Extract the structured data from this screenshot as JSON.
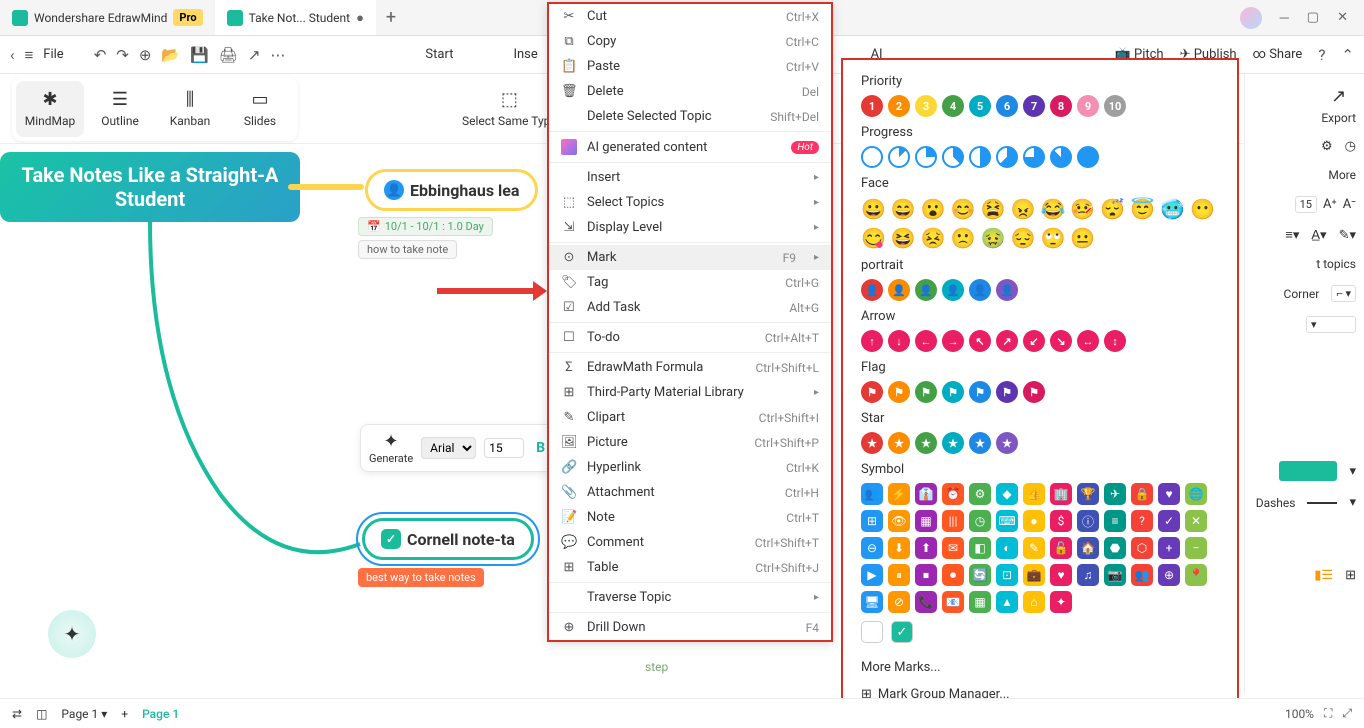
{
  "titlebar": {
    "tab1": "Wondershare EdrawMind",
    "pro": "Pro",
    "tab2": "Take Not... Student",
    "dot": "●"
  },
  "toolbar": {
    "file": "File",
    "start": "Start",
    "inse": "Inse",
    "al": "AI",
    "pitch": "Pitch",
    "publish": "Publish",
    "share": "Share"
  },
  "views": {
    "mindmap": "MindMap",
    "outline": "Outline",
    "kanban": "Kanban",
    "slides": "Slides",
    "select_same": "Select Same Type"
  },
  "canvas": {
    "root": "Take Notes Like a Straight-A Student",
    "node1": "Ebbinghaus lea",
    "chip1": "10/1 - 10/1 : 1.0 Day",
    "chip2": "how to take note",
    "node2": "Cornell note-ta",
    "tag2": "best way to take notes",
    "step": "step"
  },
  "floatbar": {
    "generate": "Generate",
    "font": "Arial",
    "size": "15"
  },
  "ctx": {
    "cut": {
      "lbl": "Cut",
      "shc": "Ctrl+X"
    },
    "copy": {
      "lbl": "Copy",
      "shc": "Ctrl+C"
    },
    "paste": {
      "lbl": "Paste",
      "shc": "Ctrl+V"
    },
    "delete": {
      "lbl": "Delete",
      "shc": "Del"
    },
    "delsel": {
      "lbl": "Delete Selected Topic",
      "shc": "Shift+Del"
    },
    "ai": {
      "lbl": "AI generated content",
      "badge": "Hot"
    },
    "insert": {
      "lbl": "Insert"
    },
    "seltopics": {
      "lbl": "Select Topics"
    },
    "displevel": {
      "lbl": "Display Level"
    },
    "mark": {
      "lbl": "Mark",
      "shc": "F9"
    },
    "tag": {
      "lbl": "Tag",
      "shc": "Ctrl+G"
    },
    "addtask": {
      "lbl": "Add Task",
      "shc": "Alt+G"
    },
    "todo": {
      "lbl": "To-do",
      "shc": "Ctrl+Alt+T"
    },
    "edrawmath": {
      "lbl": "EdrawMath Formula",
      "shc": "Ctrl+Shift+L"
    },
    "thirdparty": {
      "lbl": "Third-Party Material Library"
    },
    "clipart": {
      "lbl": "Clipart",
      "shc": "Ctrl+Shift+I"
    },
    "picture": {
      "lbl": "Picture",
      "shc": "Ctrl+Shift+P"
    },
    "hyperlink": {
      "lbl": "Hyperlink",
      "shc": "Ctrl+K"
    },
    "attachment": {
      "lbl": "Attachment",
      "shc": "Ctrl+H"
    },
    "note": {
      "lbl": "Note",
      "shc": "Ctrl+T"
    },
    "comment": {
      "lbl": "Comment",
      "shc": "Ctrl+Shift+T"
    },
    "table": {
      "lbl": "Table",
      "shc": "Ctrl+Shift+J"
    },
    "traverse": {
      "lbl": "Traverse Topic"
    },
    "drilldown": {
      "lbl": "Drill Down",
      "shc": "F4"
    }
  },
  "marks": {
    "priority": "Priority",
    "progress": "Progress",
    "face": "Face",
    "portrait": "portrait",
    "arrow": "Arrow",
    "flag": "Flag",
    "star": "Star",
    "symbol": "Symbol",
    "more": "More Marks...",
    "group": "Mark Group Manager...",
    "p_colors": [
      "#e53935",
      "#fb8c00",
      "#fdd835",
      "#43a047",
      "#00acc1",
      "#1e88e5",
      "#5e35b1",
      "#d81b60",
      "#f48fb1",
      "#9e9e9e"
    ],
    "portrait_colors": [
      "#e53935",
      "#fb8c00",
      "#43a047",
      "#00acc1",
      "#1e88e5",
      "#7e57c2"
    ],
    "arrow_colors": [
      "#e91e63",
      "#e91e63",
      "#e91e63",
      "#e91e63",
      "#e91e63",
      "#e91e63",
      "#e91e63",
      "#e91e63",
      "#e91e63",
      "#e91e63"
    ],
    "flag_colors": [
      "#e53935",
      "#fb8c00",
      "#43a047",
      "#00acc1",
      "#1e88e5",
      "#5e35b1",
      "#d81b60"
    ],
    "star_colors": [
      "#e53935",
      "#fb8c00",
      "#43a047",
      "#00acc1",
      "#1e88e5",
      "#7e57c2"
    ]
  },
  "rpanel": {
    "export": "Export",
    "more": "More",
    "size": "15",
    "topics": "t topics",
    "corner": "Corner",
    "dashes": "Dashes"
  },
  "status": {
    "page1": "Page 1",
    "page1b": "Page 1",
    "zoom": "100%"
  }
}
